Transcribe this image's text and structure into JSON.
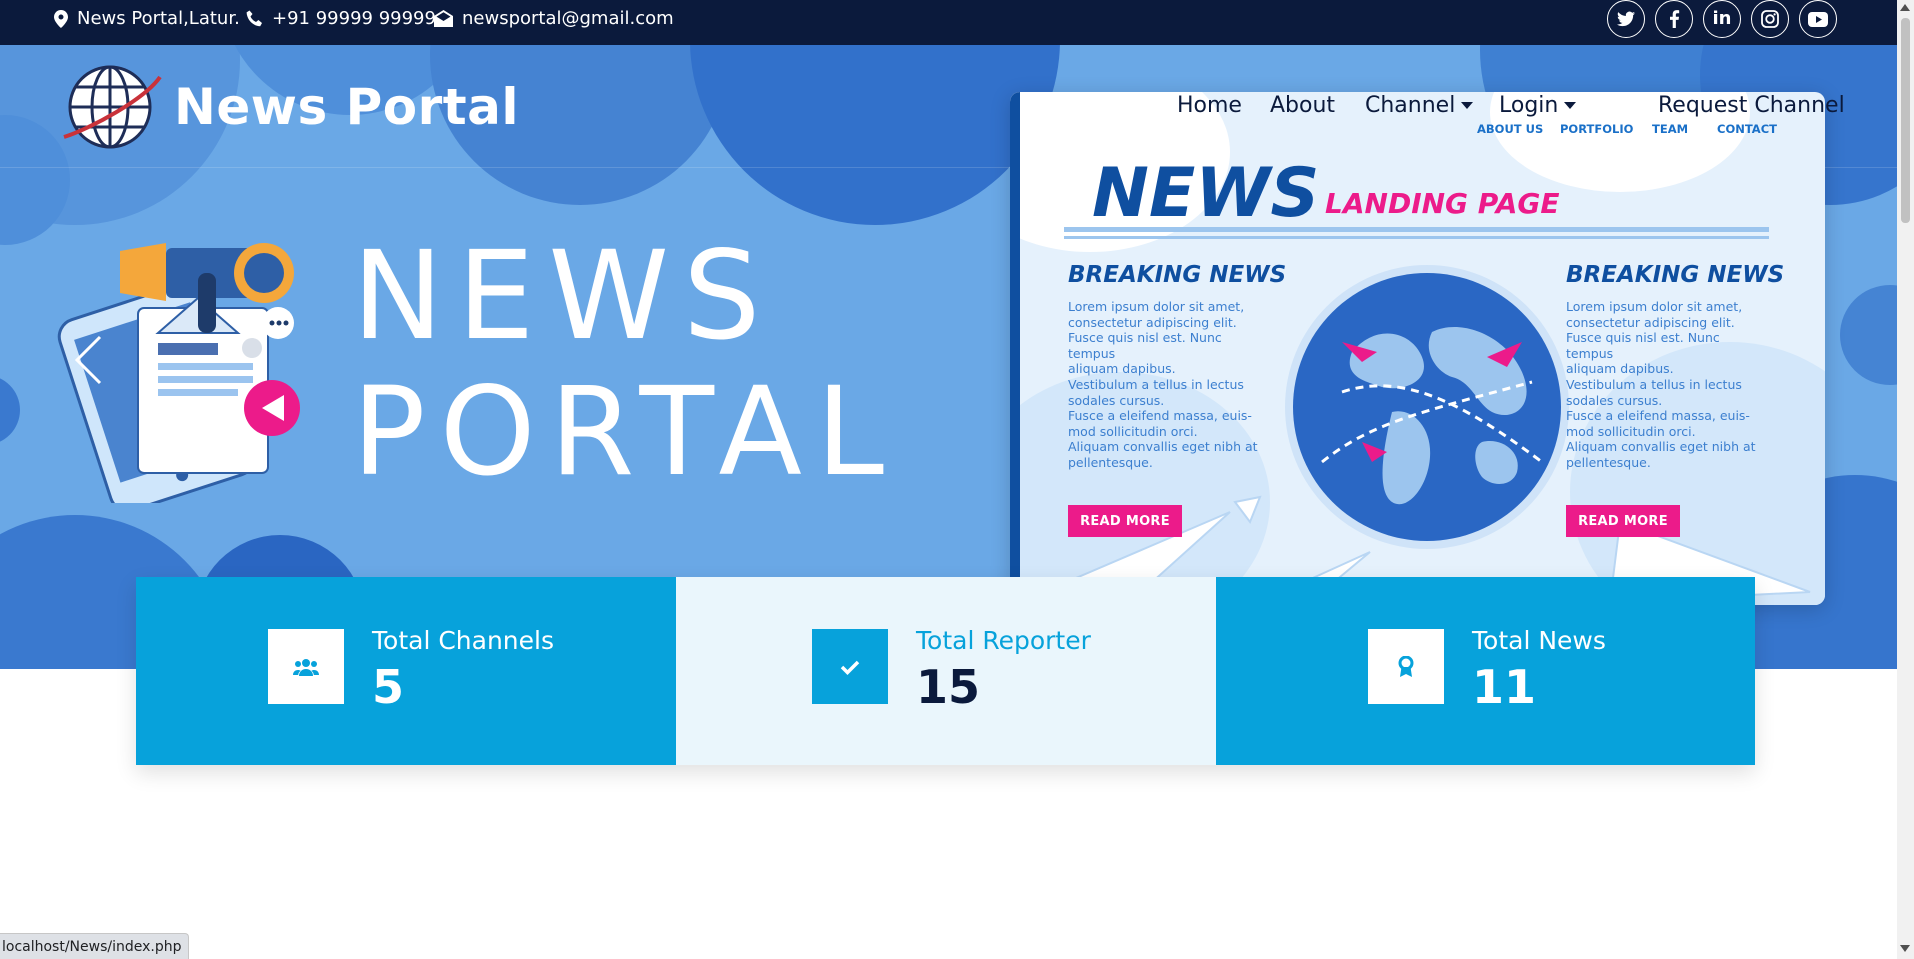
{
  "topbar": {
    "address": "News Portal,Latur.",
    "phone": "+91 99999 99999",
    "email": "newsportal@gmail.com",
    "socials": [
      "twitter-icon",
      "facebook-icon",
      "linkedin-icon",
      "instagram-icon",
      "youtube-icon"
    ]
  },
  "brand": {
    "name": "News Portal"
  },
  "nav": {
    "items": [
      "Home",
      "About",
      "Channel",
      "Login",
      "Request Channel"
    ],
    "sub_items": [
      "ABOUT US",
      "PORTFOLIO",
      "TEAM",
      "CONTACT"
    ]
  },
  "hero": {
    "line1": "NEWS",
    "line2": "PORTAL",
    "card": {
      "title": "NEWS",
      "subtitle": "LANDING PAGE",
      "columns": [
        {
          "heading": "BREAKING NEWS",
          "text": [
            "Lorem ipsum dolor sit amet,",
            "consectetur adipiscing elit.",
            "Fusce quis nisl est. Nunc tempus",
            "aliquam dapibus.",
            "Vestibulum a tellus in lectus",
            "sodales cursus.",
            "Fusce a eleifend massa, euis-",
            "mod sollicitudin orci.",
            "Aliquam convallis eget nibh at",
            "pellentesque."
          ],
          "button": "READ MORE"
        },
        {
          "heading": "BREAKING NEWS",
          "text": [
            "Lorem ipsum dolor sit amet,",
            "consectetur adipiscing elit.",
            "Fusce quis nisl est. Nunc tempus",
            "aliquam dapibus.",
            "Vestibulum a tellus in lectus",
            "sodales cursus.",
            "Fusce a eleifend massa, euis-",
            "mod sollicitudin orci.",
            "Aliquam convallis eget nibh at",
            "pellentesque."
          ],
          "button": "READ MORE"
        }
      ]
    }
  },
  "stats": [
    {
      "label": "Total Channels",
      "value": "5",
      "icon": "users-icon"
    },
    {
      "label": "Total Reporter",
      "value": "15",
      "icon": "check-icon"
    },
    {
      "label": "Total News",
      "value": "11",
      "icon": "award-icon"
    }
  ],
  "status_url": "localhost/News/index.php",
  "colors": {
    "topbar": "#0b1a3c",
    "hero": "#6aa8e6",
    "accent": "#07a2db",
    "accent_light": "#eaf6fc",
    "pink": "#ec1b8a"
  }
}
